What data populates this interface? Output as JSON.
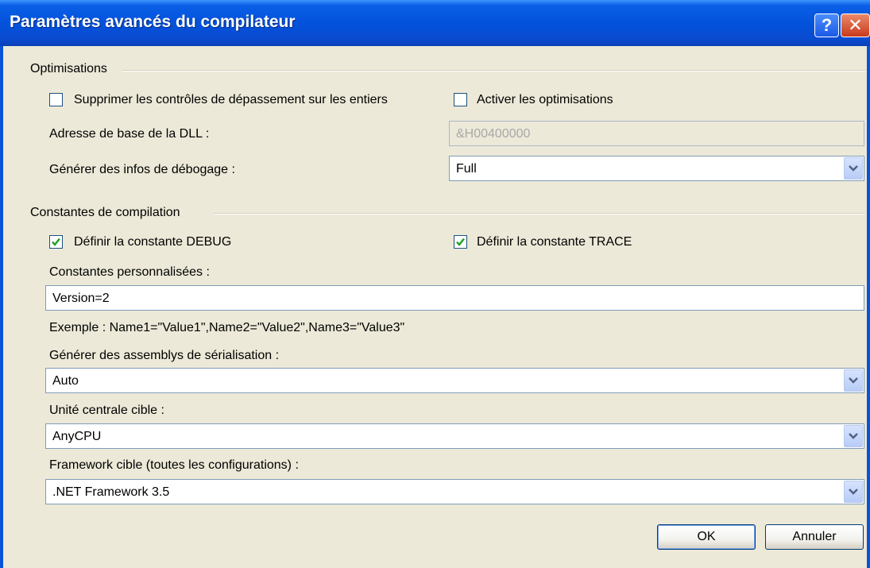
{
  "window": {
    "title": "Paramètres avancés du compilateur",
    "help_label": "?",
    "close_label": "✕"
  },
  "optimisations": {
    "group_label": "Optimisations",
    "overflow_checks": {
      "label": "Supprimer les contrôles de dépassement sur les entiers",
      "checked": false
    },
    "enable_optimizations": {
      "label": "Activer les optimisations",
      "checked": false
    },
    "dll_base_label": "Adresse de base de la DLL :",
    "dll_base_value": "&H00400000",
    "debug_info_label": "Générer des infos de débogage :",
    "debug_info_value": "Full"
  },
  "constants": {
    "group_label": "Constantes de compilation",
    "define_debug": {
      "label": "Définir la constante DEBUG",
      "checked": true
    },
    "define_trace": {
      "label": "Définir la constante TRACE",
      "checked": true
    },
    "custom_label": "Constantes personnalisées :",
    "custom_value": "Version=2",
    "example": "Exemple : Name1=\"Value1\",Name2=\"Value2\",Name3=\"Value3\""
  },
  "serialization": {
    "label": "Générer des assemblys de sérialisation :",
    "value": "Auto"
  },
  "cpu": {
    "label": "Unité centrale cible :",
    "value": "AnyCPU"
  },
  "framework": {
    "label": "Framework cible (toutes les configurations) :",
    "value": ".NET Framework 3.5"
  },
  "buttons": {
    "ok": "OK",
    "cancel": "Annuler"
  },
  "colors": {
    "titlebar": "#0352dc",
    "dialog_bg": "#ece9d8",
    "checkmark": "#21a121"
  }
}
